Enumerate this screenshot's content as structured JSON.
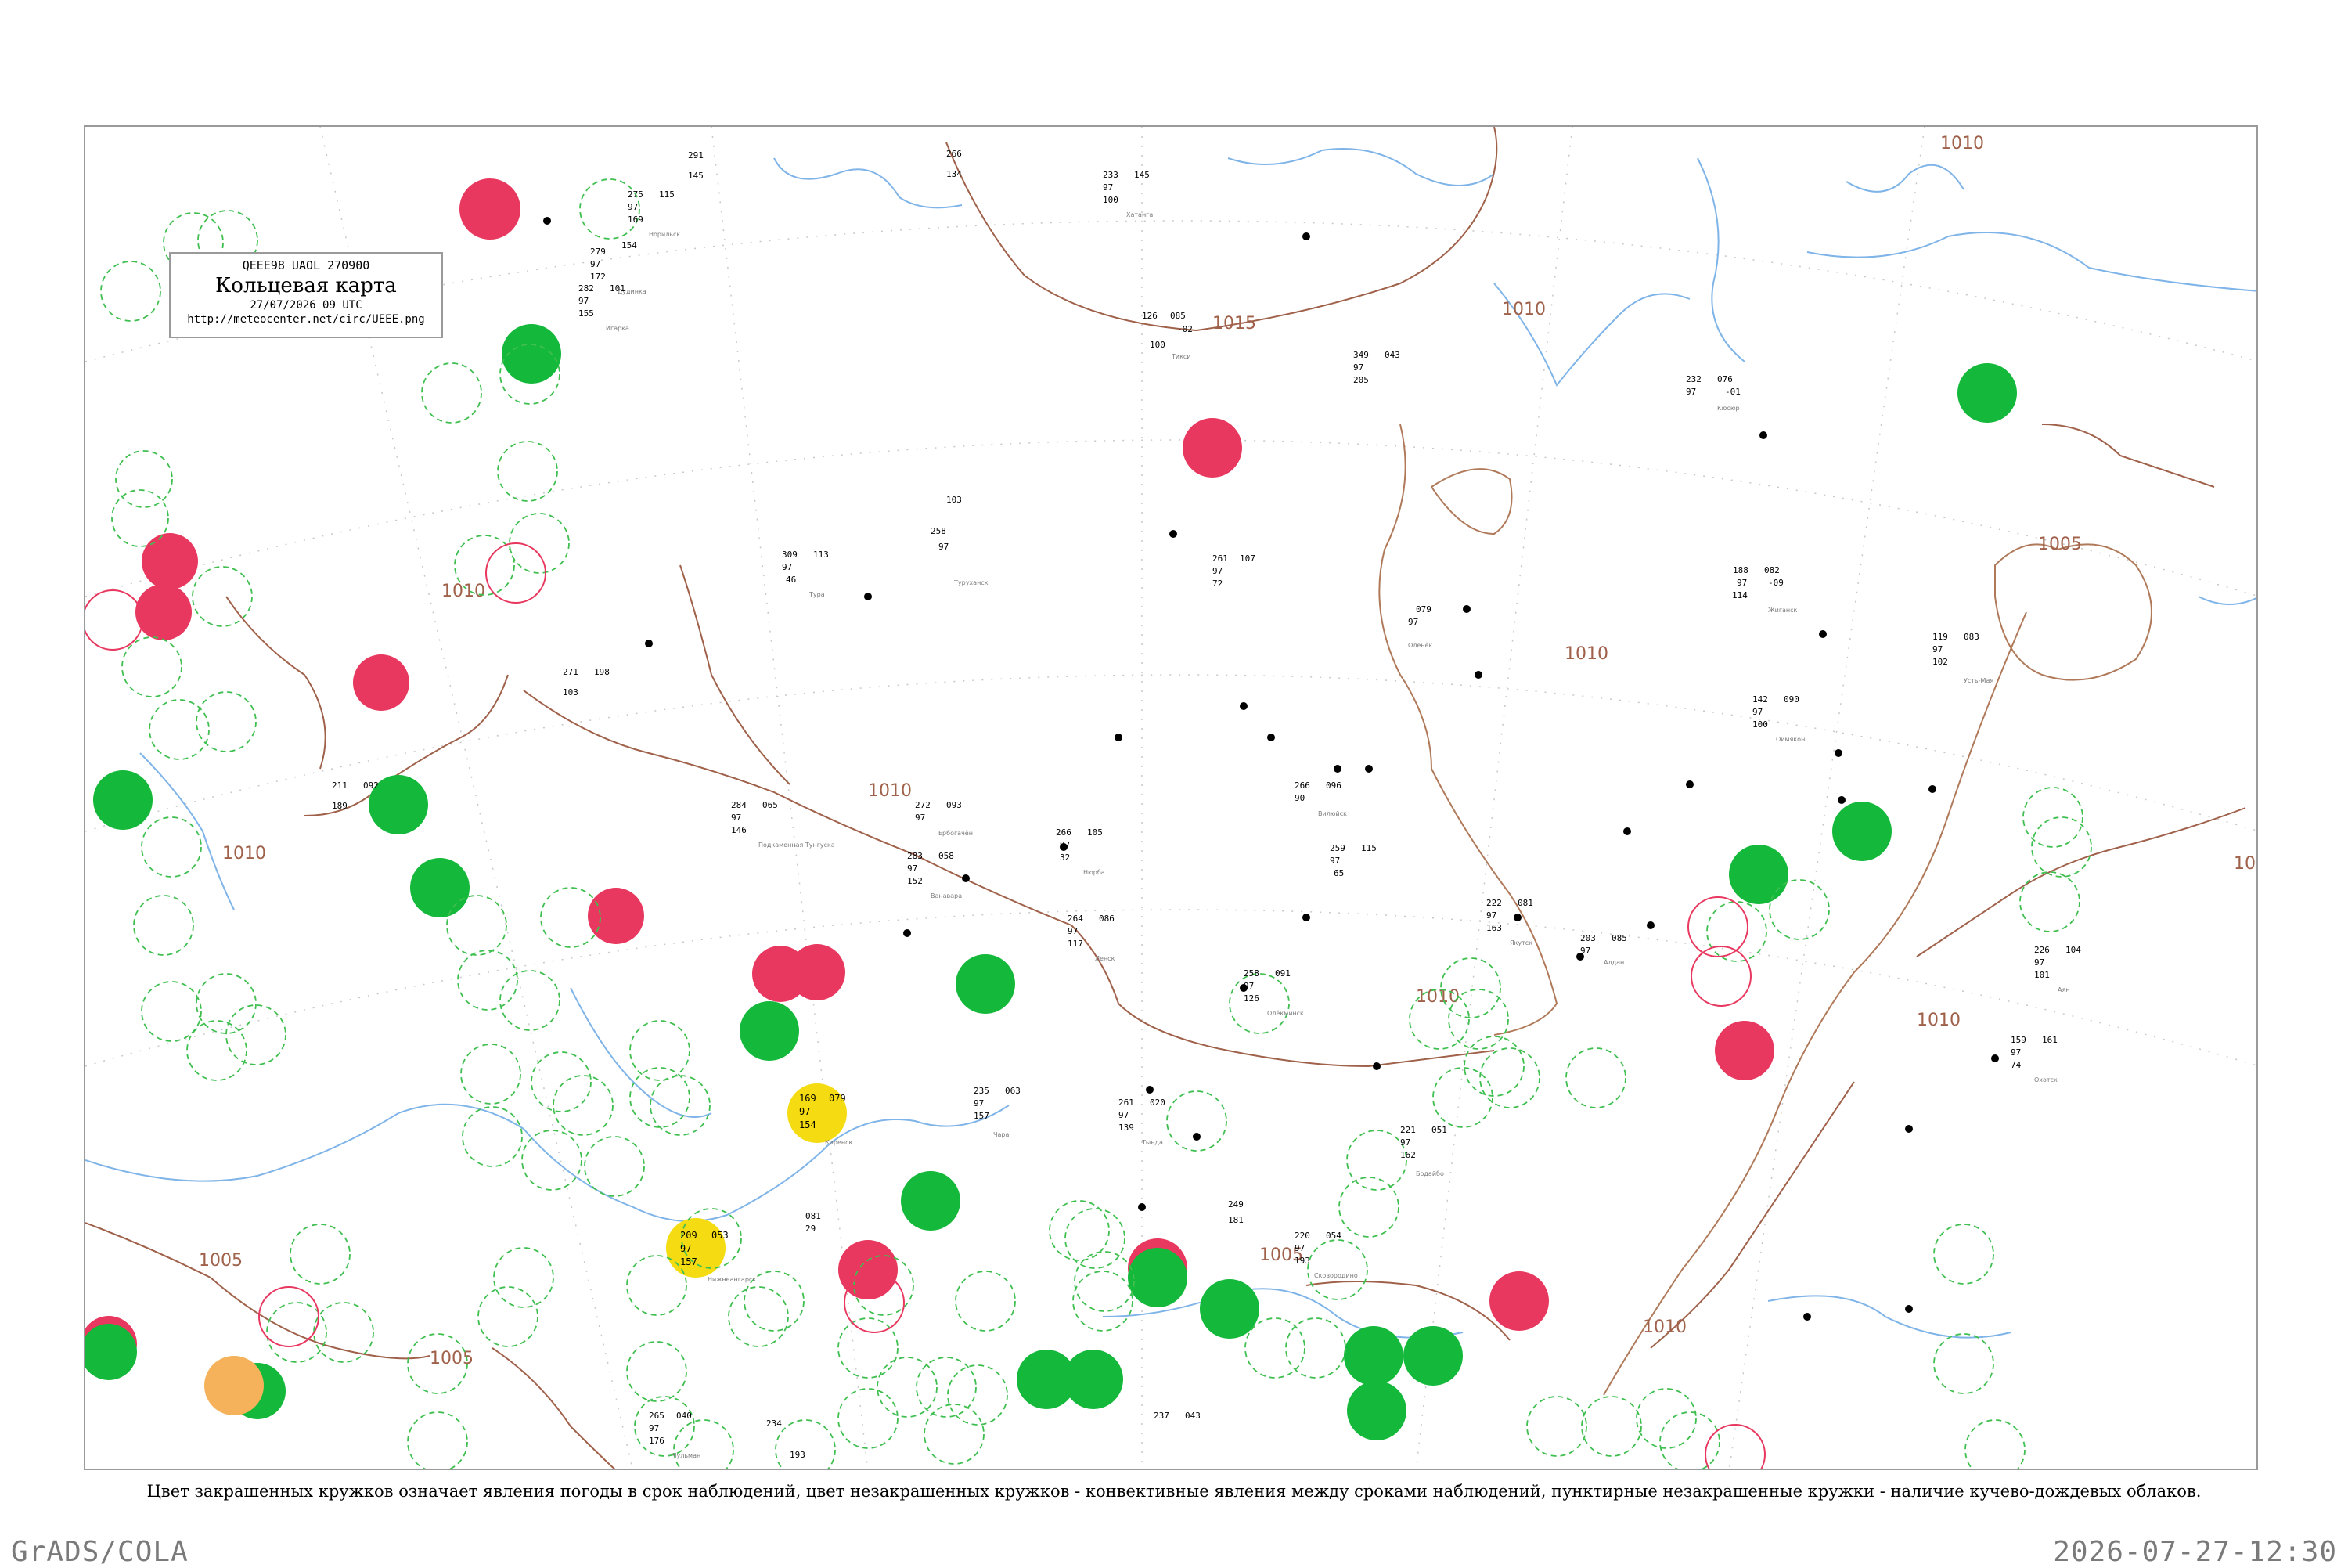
{
  "header": {
    "code": "QEEE98  UAOL  270900",
    "title": "Кольцевая карта",
    "datetime": "27/07/2026 09 UTC",
    "url": "http://meteocenter.net/circ/UEEE.png"
  },
  "caption": "Цвет закрашенных кружков означает явления погоды в срок наблюдений, цвет незакрашенных кружков - конвективные явления между сроками наблюдений, пунктирные незакрашенные кружки - наличие кучево-дождевых облаков.",
  "footer": {
    "left": "GrADS/COLA",
    "right": "2026-07-27-12:30"
  },
  "colors": {
    "isobar": "#a0614a",
    "water": "#7fb4e8",
    "thunder_red": "#e8385f",
    "rain_green": "#14b83a",
    "fog_yellow": "#f5dc12",
    "haze_orange": "#f5b25a",
    "cb_dashed": "#3fbf4f",
    "gridline": "#c8c8c8"
  },
  "isobar_labels": [
    "1010",
    "1015",
    "1010",
    "1010",
    "1005",
    "1010",
    "1010",
    "1010",
    "1010",
    "1005",
    "1005",
    "1005",
    "1010",
    "101",
    "1010"
  ],
  "stations": [
    {
      "name": "Тикси",
      "idx": "21824",
      "t": "126",
      "p": "085"
    },
    {
      "name": "Кюсюр",
      "idx": "24105",
      "t": "232",
      "p": "076"
    },
    {
      "name": "Жиганск",
      "idx": "24143",
      "t": "188",
      "p": "082"
    },
    {
      "name": "Усть-Мая",
      "idx": "24382",
      "t": "119",
      "p": "083"
    },
    {
      "name": "Оленёк",
      "idx": "24125",
      "t": "262",
      "p": "103"
    },
    {
      "name": "Туруханск",
      "idx": "23472",
      "t": "253",
      "p": "081"
    },
    {
      "name": "Ванавара",
      "idx": "24908",
      "t": "283",
      "p": "058"
    },
    {
      "name": "Тура",
      "idx": "24507",
      "t": "309",
      "p": "113"
    },
    {
      "name": "Ербогачён",
      "idx": "24817",
      "t": "272",
      "p": "093"
    },
    {
      "name": "Вилюйск",
      "idx": "24641",
      "t": "266",
      "p": "096"
    },
    {
      "name": "Олёкминск",
      "idx": "24944",
      "t": "258",
      "p": "091"
    },
    {
      "name": "Киренск",
      "idx": "30230",
      "t": "169",
      "p": "079"
    },
    {
      "name": "Бодайбо",
      "idx": "30372",
      "t": "221",
      "p": "051"
    },
    {
      "name": "Чара",
      "idx": "30477",
      "t": "235",
      "p": "063"
    },
    {
      "name": "Нижнеангарск",
      "idx": "30433",
      "t": "209",
      "p": "053"
    },
    {
      "name": "Алдан",
      "idx": "31004",
      "t": "203",
      "p": "085"
    },
    {
      "name": "Нюрба",
      "idx": "24728",
      "t": "266",
      "p": "105"
    },
    {
      "name": "Ленск",
      "idx": "24826",
      "t": "264",
      "p": "086"
    },
    {
      "name": "Якутск",
      "idx": "24959",
      "t": "222",
      "p": "081"
    },
    {
      "name": "Оймякон",
      "idx": "24688",
      "t": "142",
      "p": "090"
    },
    {
      "name": "Охотск",
      "idx": "31088",
      "t": "159",
      "p": "161"
    },
    {
      "name": "Аян",
      "idx": "31168",
      "t": "226",
      "p": "104"
    },
    {
      "name": "Тында",
      "idx": "30971",
      "t": "261",
      "p": "020"
    },
    {
      "name": "Сковородино",
      "idx": "30673",
      "t": "220",
      "p": "054"
    },
    {
      "name": "Чульман",
      "idx": "31026",
      "t": "265",
      "p": "040"
    },
    {
      "name": "Подкаменная Тунгуска",
      "idx": "23884",
      "t": "284",
      "p": "065"
    },
    {
      "name": "Хатанга",
      "idx": "20891",
      "t": "233",
      "p": "145"
    },
    {
      "name": "Дудинка",
      "idx": "23074",
      "t": "279",
      "p": "154"
    },
    {
      "name": "Игарка",
      "idx": "23274",
      "t": "282",
      "p": "101"
    },
    {
      "name": "Норильск",
      "idx": "23078",
      "t": "275",
      "p": "115"
    }
  ]
}
